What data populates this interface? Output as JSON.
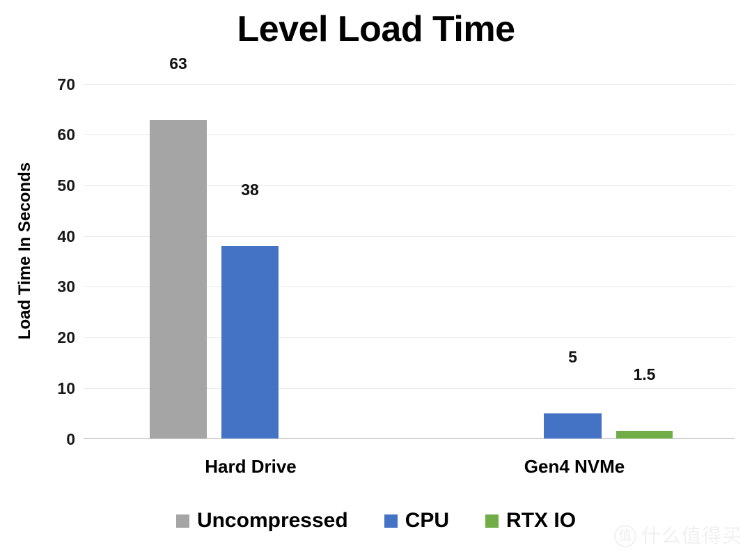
{
  "chart_data": {
    "type": "bar",
    "title": "Level Load Time",
    "xlabel": "",
    "ylabel": "Load Time In Seconds",
    "categories": [
      "Hard Drive",
      "Gen4 NVMe"
    ],
    "series": [
      {
        "name": "Uncompressed",
        "color": "#A5A5A5",
        "values": [
          63,
          null
        ]
      },
      {
        "name": "CPU",
        "color": "#4472C4",
        "values": [
          38,
          5
        ]
      },
      {
        "name": "RTX IO",
        "color": "#70AD47",
        "values": [
          null,
          1.5
        ]
      }
    ],
    "data_labels": {
      "hard_drive_uncompressed": "63",
      "hard_drive_cpu": "38",
      "gen4_nvme_cpu": "5",
      "gen4_nvme_rtxio": "1.5"
    },
    "ylim": [
      0,
      70
    ],
    "ytick_step": 10,
    "ytick_labels": [
      "70",
      "60",
      "50",
      "40",
      "30",
      "20",
      "10",
      "0"
    ],
    "grid": true,
    "legend_position": "bottom"
  },
  "watermark": {
    "mark": "值",
    "text": "什么值得买"
  }
}
